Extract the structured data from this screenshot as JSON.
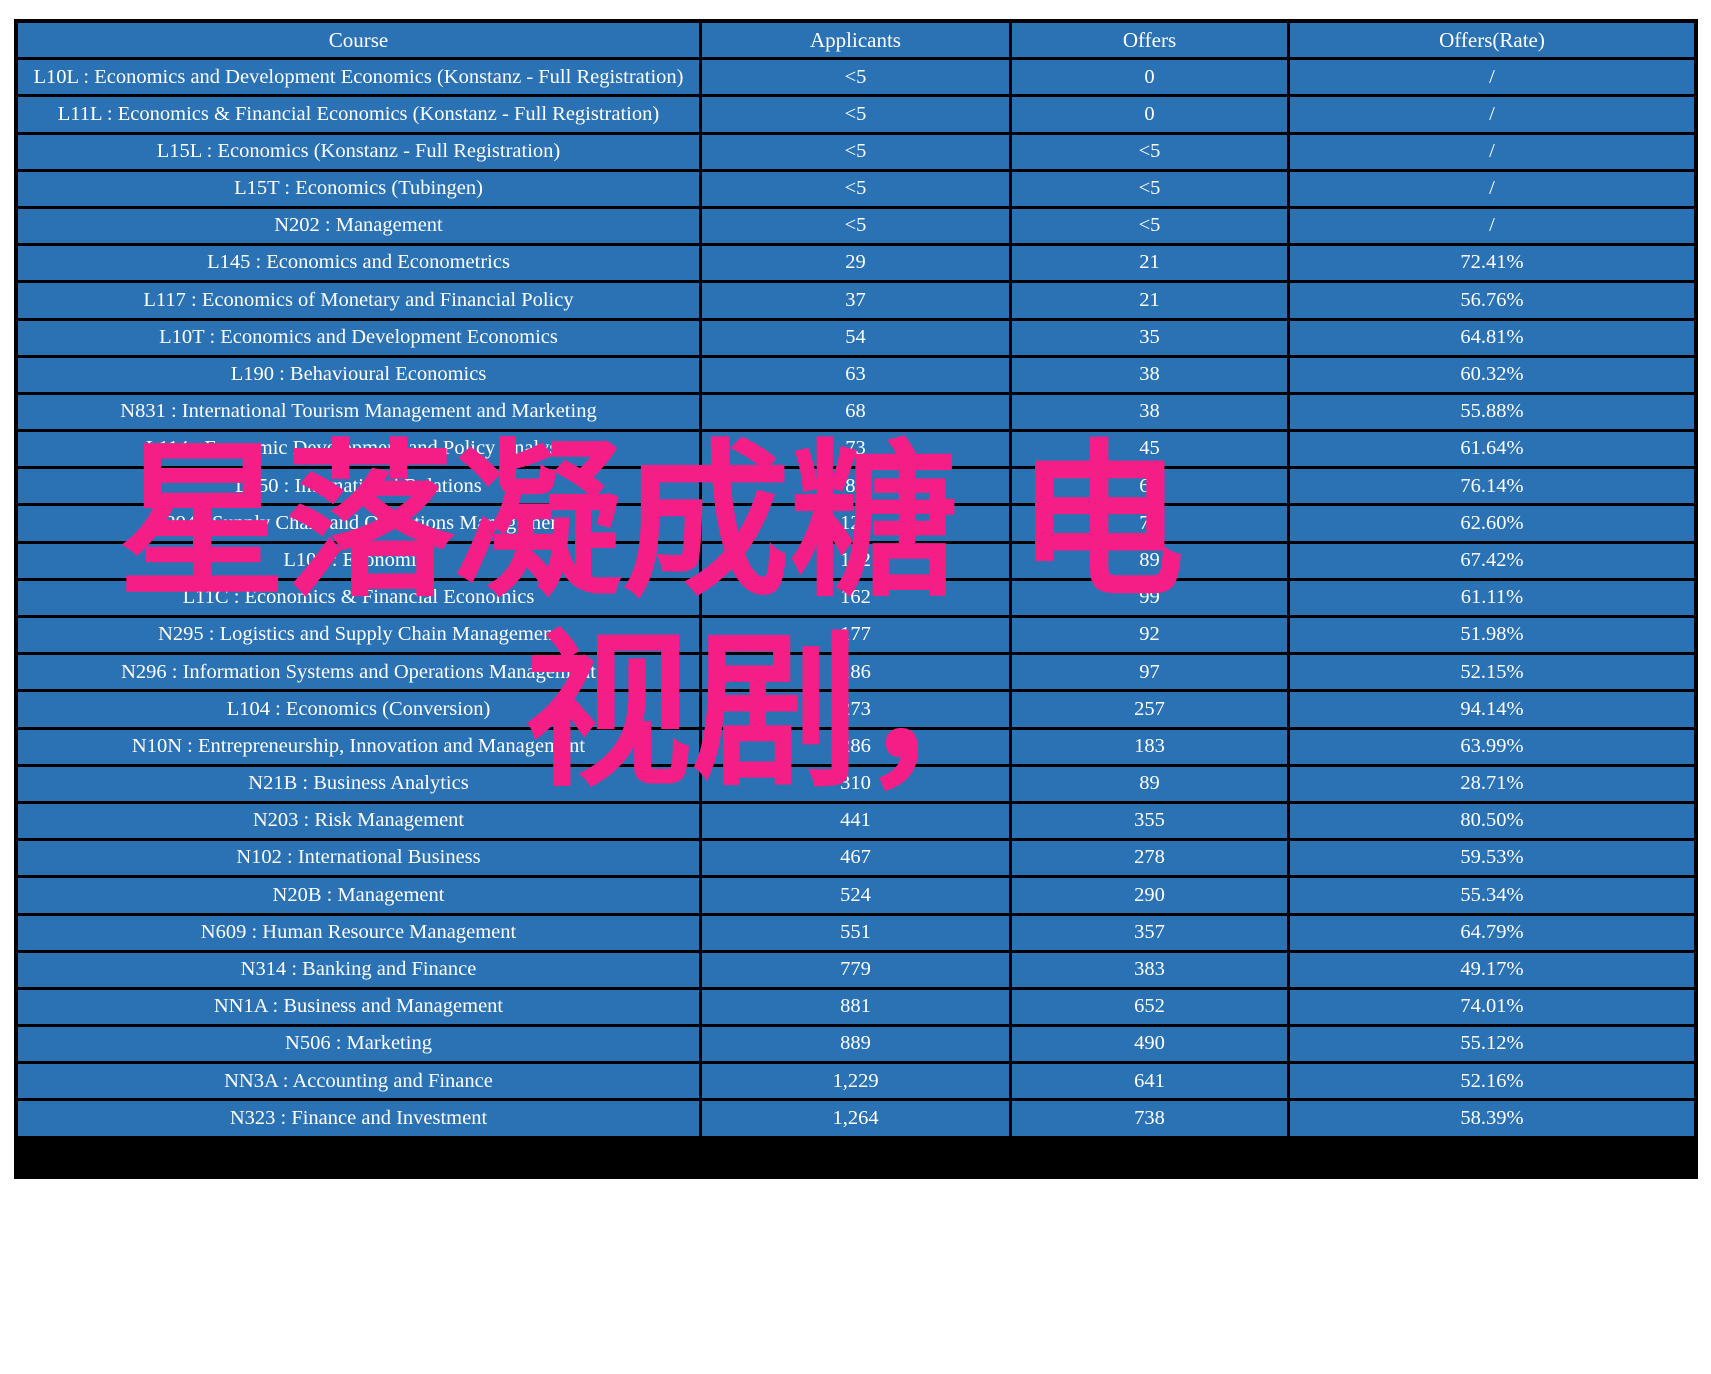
{
  "table": {
    "columns": [
      "Course",
      "Applicants",
      "Offers",
      "Offers(Rate)"
    ],
    "rows": [
      {
        "course": "L10L : Economics and Development Economics (Konstanz - Full Registration)",
        "applicants": "<5",
        "offers": "0",
        "rate": "/",
        "course_color": "white",
        "applicants_color": "white",
        "rate_color": "white"
      },
      {
        "course": "L11L : Economics & Financial Economics (Konstanz - Full Registration)",
        "applicants": "<5",
        "offers": "0",
        "rate": "/",
        "course_color": "white",
        "applicants_color": "white",
        "rate_color": "white"
      },
      {
        "course": "L15L : Economics (Konstanz - Full Registration)",
        "applicants": "<5",
        "offers": "<5",
        "rate": "/",
        "course_color": "white",
        "applicants_color": "white",
        "rate_color": "white"
      },
      {
        "course": "L15T : Economics (Tubingen)",
        "applicants": "<5",
        "offers": "<5",
        "rate": "/",
        "course_color": "white",
        "applicants_color": "white",
        "rate_color": "white"
      },
      {
        "course": "N202 : Management",
        "applicants": "<5",
        "offers": "<5",
        "rate": "/",
        "course_color": "white",
        "applicants_color": "white",
        "rate_color": "white"
      },
      {
        "course": "L145 : Economics and Econometrics",
        "applicants": "29",
        "offers": "21",
        "rate": "72.41%",
        "course_color": "white",
        "applicants_color": "white",
        "rate_color": "red"
      },
      {
        "course": "L117 : Economics of Monetary and Financial Policy",
        "applicants": "37",
        "offers": "21",
        "rate": "56.76%",
        "course_color": "white",
        "applicants_color": "white",
        "rate_color": "white"
      },
      {
        "course": "L10T : Economics and Development Economics",
        "applicants": "54",
        "offers": "35",
        "rate": "64.81%",
        "course_color": "white",
        "applicants_color": "white",
        "rate_color": "white"
      },
      {
        "course": "L190 : Behavioural Economics",
        "applicants": "63",
        "offers": "38",
        "rate": "60.32%",
        "course_color": "white",
        "applicants_color": "white",
        "rate_color": "white"
      },
      {
        "course": "N831 : International Tourism Management and Marketing",
        "applicants": "68",
        "offers": "38",
        "rate": "55.88%",
        "course_color": "white",
        "applicants_color": "white",
        "rate_color": "white"
      },
      {
        "course": "L114 : Economic Development and Policy Analysis",
        "applicants": "73",
        "offers": "45",
        "rate": "61.64%",
        "course_color": "white",
        "applicants_color": "white",
        "rate_color": "white"
      },
      {
        "course": "L250 : International Relations",
        "applicants": "88",
        "offers": "67",
        "rate": "76.14%",
        "course_color": "white",
        "applicants_color": "white",
        "rate_color": "red"
      },
      {
        "course": "N294 : Supply Chain and Operations Management",
        "applicants": "123",
        "offers": "77",
        "rate": "62.60%",
        "course_color": "white",
        "applicants_color": "white",
        "rate_color": "white"
      },
      {
        "course": "L105 : Economics",
        "applicants": "132",
        "offers": "89",
        "rate": "67.42%",
        "course_color": "white",
        "applicants_color": "white",
        "rate_color": "white"
      },
      {
        "course": "L11C : Economics & Financial Economics",
        "applicants": "162",
        "offers": "99",
        "rate": "61.11%",
        "course_color": "white",
        "applicants_color": "white",
        "rate_color": "white"
      },
      {
        "course": "N295 : Logistics and Supply Chain Management",
        "applicants": "177",
        "offers": "92",
        "rate": "51.98%",
        "course_color": "white",
        "applicants_color": "white",
        "rate_color": "white"
      },
      {
        "course": "N296 : Information Systems and Operations Management",
        "applicants": "186",
        "offers": "97",
        "rate": "52.15%",
        "course_color": "white",
        "applicants_color": "white",
        "rate_color": "white"
      },
      {
        "course": "L104 : Economics (Conversion)",
        "applicants": "273",
        "offers": "257",
        "rate": "94.14%",
        "course_color": "white",
        "applicants_color": "white",
        "rate_color": "red"
      },
      {
        "course": "N10N : Entrepreneurship, Innovation and Management",
        "applicants": "286",
        "offers": "183",
        "rate": "63.99%",
        "course_color": "white",
        "applicants_color": "white",
        "rate_color": "white"
      },
      {
        "course": "N21B : Business Analytics",
        "applicants": "310",
        "offers": "89",
        "rate": "28.71%",
        "course_color": "white",
        "applicants_color": "white",
        "rate_color": "white"
      },
      {
        "course": "N203 : Risk Management",
        "applicants": "441",
        "offers": "355",
        "rate": "80.50%",
        "course_color": "white",
        "applicants_color": "white",
        "rate_color": "red"
      },
      {
        "course": "N102 : International Business",
        "applicants": "467",
        "offers": "278",
        "rate": "59.53%",
        "course_color": "white",
        "applicants_color": "white",
        "rate_color": "white"
      },
      {
        "course": "N20B : Management",
        "applicants": "524",
        "offers": "290",
        "rate": "55.34%",
        "course_color": "yellow",
        "applicants_color": "yellow",
        "rate_color": "white"
      },
      {
        "course": "N609 : Human Resource Management",
        "applicants": "551",
        "offers": "357",
        "rate": "64.79%",
        "course_color": "yellow",
        "applicants_color": "yellow",
        "rate_color": "white"
      },
      {
        "course": "N314 : Banking and Finance",
        "applicants": "779",
        "offers": "383",
        "rate": "49.17%",
        "course_color": "yellow",
        "applicants_color": "yellow",
        "rate_color": "white"
      },
      {
        "course": "NN1A : Business and Management",
        "applicants": "881",
        "offers": "652",
        "rate": "74.01%",
        "course_color": "yellow",
        "applicants_color": "yellow",
        "rate_color": "red"
      },
      {
        "course": "N506 : Marketing",
        "applicants": "889",
        "offers": "490",
        "rate": "55.12%",
        "course_color": "yellow",
        "applicants_color": "yellow",
        "rate_color": "white"
      },
      {
        "course": "NN3A : Accounting and Finance",
        "applicants": "1,229",
        "offers": "641",
        "rate": "52.16%",
        "course_color": "yellow",
        "applicants_color": "yellow",
        "rate_color": "white"
      },
      {
        "course": "N323 : Finance and Investment",
        "applicants": "1,264",
        "offers": "738",
        "rate": "58.39%",
        "course_color": "yellow",
        "applicants_color": "yellow",
        "rate_color": "white"
      }
    ]
  },
  "watermark": {
    "line1": "星落凝成糖 电",
    "line2": "视剧，",
    "color": "#F51D86"
  }
}
